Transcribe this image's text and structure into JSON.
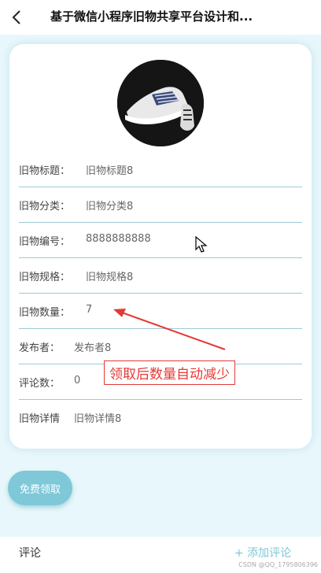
{
  "header": {
    "title": "基于微信小程序旧物共享平台设计和..."
  },
  "fields": [
    {
      "label": "旧物标题：",
      "value": "旧物标题8"
    },
    {
      "label": "旧物分类：",
      "value": "旧物分类8"
    },
    {
      "label": "旧物编号：",
      "value": "8888888888"
    },
    {
      "label": "旧物规格：",
      "value": "旧物规格8"
    },
    {
      "label": "旧物数量：",
      "value": "7"
    },
    {
      "label": "发布者：",
      "value": "发布者8"
    },
    {
      "label": "评论数：",
      "value": "0"
    },
    {
      "label": "旧物详情",
      "value": "旧物详情8"
    }
  ],
  "annotation": "领取后数量自动减少",
  "actions": {
    "claim_label": "免费领取"
  },
  "comments": {
    "label": "评论",
    "add_label": "+ 添加评论"
  },
  "watermark": "CSDN @QQ_1795806396",
  "colors": {
    "accent": "#7ec8d8",
    "annotation": "#e53935",
    "divider": "#9ccad8"
  }
}
